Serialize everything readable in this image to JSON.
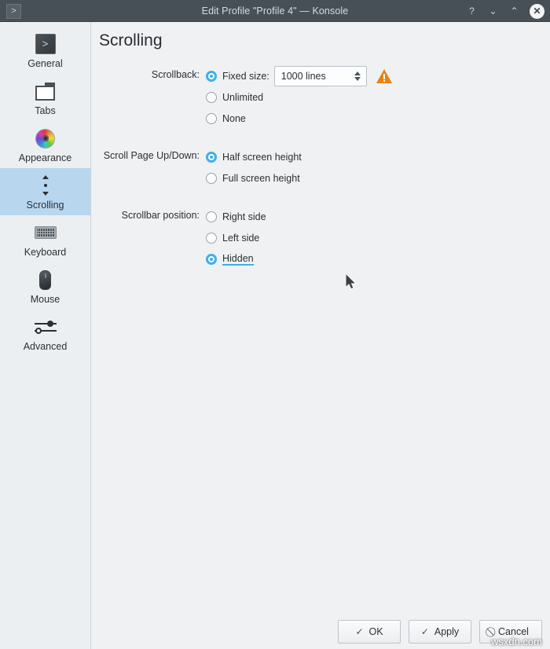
{
  "window": {
    "title": "Edit Profile \"Profile 4\" — Konsole",
    "app_icon": "terminal-icon",
    "controls": {
      "help": "?",
      "minimize": "⌄",
      "maximize": "⌃",
      "close": "✕"
    }
  },
  "sidebar": {
    "items": [
      {
        "label": "General",
        "icon": "terminal-icon",
        "selected": false
      },
      {
        "label": "Tabs",
        "icon": "folder-icon",
        "selected": false
      },
      {
        "label": "Appearance",
        "icon": "color-wheel-icon",
        "selected": false
      },
      {
        "label": "Scrolling",
        "icon": "scroll-arrows-icon",
        "selected": true
      },
      {
        "label": "Keyboard",
        "icon": "keyboard-icon",
        "selected": false
      },
      {
        "label": "Mouse",
        "icon": "mouse-icon",
        "selected": false
      },
      {
        "label": "Advanced",
        "icon": "sliders-icon",
        "selected": false
      }
    ]
  },
  "page": {
    "title": "Scrolling",
    "groups": [
      {
        "label": "Scrollback:",
        "options": [
          {
            "label": "Fixed size:",
            "selected": true
          },
          {
            "label": "Unlimited",
            "selected": false
          },
          {
            "label": "None",
            "selected": false
          }
        ],
        "spinbox": {
          "value": "1000 lines"
        },
        "warning_icon": "warning-triangle-icon"
      },
      {
        "label": "Scroll Page Up/Down:",
        "options": [
          {
            "label": "Half screen height",
            "selected": true
          },
          {
            "label": "Full screen height",
            "selected": false
          }
        ]
      },
      {
        "label": "Scrollbar position:",
        "options": [
          {
            "label": "Right side",
            "selected": false
          },
          {
            "label": "Left side",
            "selected": false
          },
          {
            "label": "Hidden",
            "selected": true,
            "focused": true,
            "hovered": true
          }
        ]
      }
    ]
  },
  "footer": {
    "buttons": [
      {
        "label": "OK",
        "icon": "check-icon",
        "glyph": "✓"
      },
      {
        "label": "Apply",
        "icon": "check-icon",
        "glyph": "✓"
      },
      {
        "label": "Cancel",
        "icon": "cancel-icon",
        "glyph": "⃠"
      }
    ]
  },
  "watermark": {
    "text": "wsxdn.com"
  },
  "colors": {
    "titlebar": "#475057",
    "accent": "#3daee9",
    "selection": "#b8d7ef",
    "warning": "#e8820c",
    "background": "#eff1f3",
    "sidebar": "#eceff1"
  }
}
